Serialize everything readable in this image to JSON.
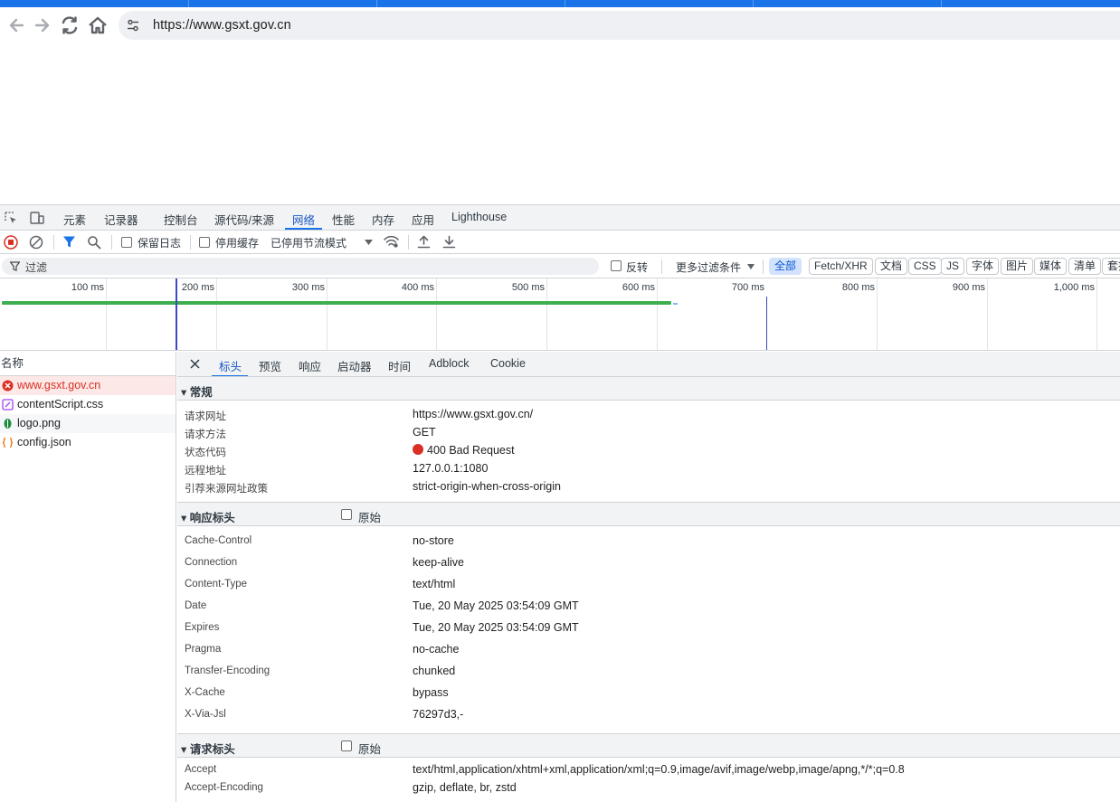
{
  "browser": {
    "url": "https://www.gsxt.gov.cn"
  },
  "devtools": {
    "tabs": [
      "元素",
      "记录器",
      "控制台",
      "源代码/来源",
      "网络",
      "性能",
      "内存",
      "应用",
      "Lighthouse"
    ],
    "active_tab": "网络",
    "toolbar": {
      "preserve_log": "保留日志",
      "disable_cache": "停用缓存",
      "throttling": "已停用节流模式"
    },
    "filter": {
      "placeholder": "过滤",
      "invert": "反转",
      "more_filters": "更多过滤条件",
      "types": [
        "全部",
        "Fetch/XHR",
        "文档",
        "CSS",
        "JS",
        "字体",
        "图片",
        "媒体",
        "清单",
        "套接字"
      ],
      "active_type": "全部"
    },
    "overview": {
      "ticks": [
        "100 ms",
        "200 ms",
        "300 ms",
        "400 ms",
        "500 ms",
        "600 ms",
        "700 ms",
        "800 ms",
        "900 ms",
        "1,000 ms"
      ]
    },
    "requests": {
      "column": "名称",
      "items": [
        {
          "name": "www.gsxt.gov.cn",
          "type": "error"
        },
        {
          "name": "contentScript.css",
          "type": "css"
        },
        {
          "name": "logo.png",
          "type": "image"
        },
        {
          "name": "config.json",
          "type": "json"
        }
      ]
    },
    "details": {
      "tabs": [
        "标头",
        "预览",
        "响应",
        "启动器",
        "时间",
        "Adblock",
        "Cookie"
      ],
      "active_tab": "标头",
      "general": {
        "title": "常规",
        "rows": [
          {
            "name": "请求网址",
            "value": "https://www.gsxt.gov.cn/"
          },
          {
            "name": "请求方法",
            "value": "GET"
          },
          {
            "name": "状态代码",
            "value": "400 Bad Request"
          },
          {
            "name": "远程地址",
            "value": "127.0.0.1:1080"
          },
          {
            "name": "引荐来源网址政策",
            "value": "strict-origin-when-cross-origin"
          }
        ]
      },
      "response_headers": {
        "title": "响应标头",
        "raw_label": "原始",
        "rows": [
          {
            "name": "Cache-Control",
            "value": "no-store"
          },
          {
            "name": "Connection",
            "value": "keep-alive"
          },
          {
            "name": "Content-Type",
            "value": "text/html"
          },
          {
            "name": "Date",
            "value": "Tue, 20 May 2025 03:54:09 GMT"
          },
          {
            "name": "Expires",
            "value": "Tue, 20 May 2025 03:54:09 GMT"
          },
          {
            "name": "Pragma",
            "value": "no-cache"
          },
          {
            "name": "Transfer-Encoding",
            "value": "chunked"
          },
          {
            "name": "X-Cache",
            "value": "bypass"
          },
          {
            "name": "X-Via-Jsl",
            "value": "76297d3,-"
          }
        ]
      },
      "request_headers": {
        "title": "请求标头",
        "raw_label": "原始",
        "rows": [
          {
            "name": "Accept",
            "value": "text/html,application/xhtml+xml,application/xml;q=0.9,image/avif,image/webp,image/apng,*/*;q=0.8"
          },
          {
            "name": "Accept-Encoding",
            "value": "gzip, deflate, br, zstd"
          }
        ]
      }
    }
  },
  "colors": {
    "accent": "#1a73e8",
    "error": "#d93025",
    "load_bar": "#3fae4f"
  }
}
